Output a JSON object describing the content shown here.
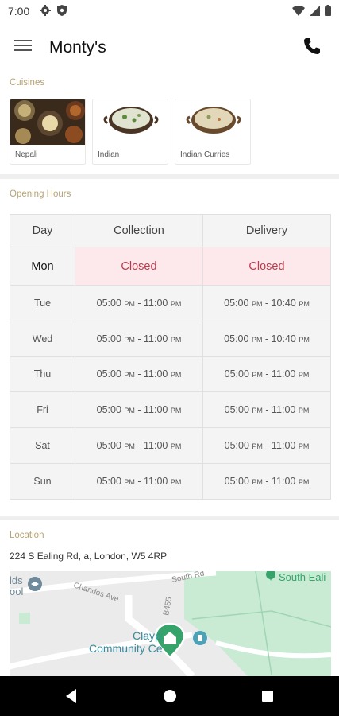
{
  "status_bar": {
    "time": "7:00"
  },
  "app_bar": {
    "title": "Monty's",
    "icons": [
      "menu-icon",
      "phone-icon"
    ]
  },
  "cuisines": {
    "label": "Cuisines",
    "items": [
      {
        "name": "Nepali"
      },
      {
        "name": "Indian"
      },
      {
        "name": "Indian Curries"
      }
    ]
  },
  "opening_hours": {
    "label": "Opening Hours",
    "headers": [
      "Day",
      "Collection",
      "Delivery"
    ],
    "rows": [
      {
        "day": "Mon",
        "collection": "Closed",
        "delivery": "Closed"
      },
      {
        "day": "Tue",
        "collection": "05:00 PM - 11:00 PM",
        "delivery": "05:00 PM - 10:40 PM"
      },
      {
        "day": "Wed",
        "collection": "05:00 PM - 11:00 PM",
        "delivery": "05:00 PM - 10:40 PM"
      },
      {
        "day": "Thu",
        "collection": "05:00 PM - 11:00 PM",
        "delivery": "05:00 PM - 11:00 PM"
      },
      {
        "day": "Fri",
        "collection": "05:00 PM - 11:00 PM",
        "delivery": "05:00 PM - 11:00 PM"
      },
      {
        "day": "Sat",
        "collection": "05:00 PM - 11:00 PM",
        "delivery": "05:00 PM - 11:00 PM"
      },
      {
        "day": "Sun",
        "collection": "05:00 PM - 11:00 PM",
        "delivery": "05:00 PM - 11:00 PM"
      }
    ]
  },
  "location": {
    "label": "Location",
    "address": "224 S Ealing Rd, a, London, W5 4RP",
    "map_labels": {
      "road_chandos": "Chandos Ave",
      "road_south": "South Rd",
      "road_b455": "B455",
      "place_south_ealing": "South Eali",
      "place_clayponds": "Clayp",
      "place_community": "Community Ce",
      "partial_left_top": "lds",
      "partial_left_bottom": "ool"
    }
  },
  "colors": {
    "accent_label": "#b6a377",
    "closed_bg": "#fde9ec",
    "closed_text": "#c0384b",
    "map_green": "#c9ead3",
    "map_marker": "#35a36a"
  }
}
